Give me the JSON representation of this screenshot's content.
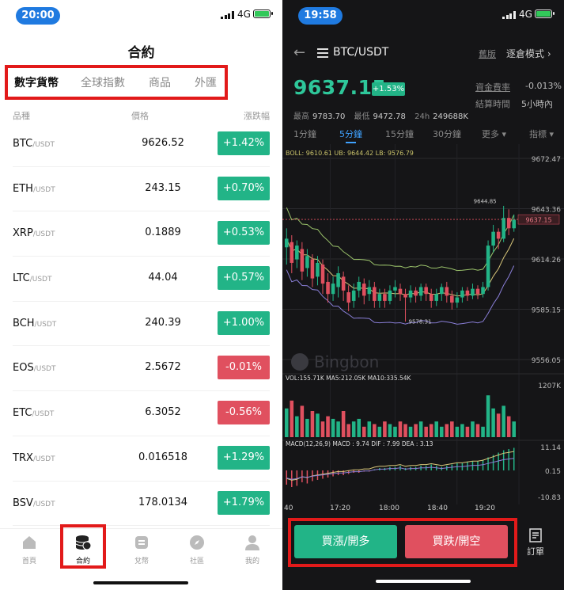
{
  "left": {
    "status": {
      "time": "20:00",
      "network": "4G"
    },
    "title": "合約",
    "category_tabs": [
      "數字貨幣",
      "全球指數",
      "商品",
      "外匯"
    ],
    "columns": {
      "symbol": "品種",
      "price": "價格",
      "change": "漲跌幅"
    },
    "rows": [
      {
        "symbol": "BTC",
        "quote": "/USDT",
        "price": "9626.52",
        "change": "+1.42%",
        "direction": "up"
      },
      {
        "symbol": "ETH",
        "quote": "/USDT",
        "price": "243.15",
        "change": "+0.70%",
        "direction": "up"
      },
      {
        "symbol": "XRP",
        "quote": "/USDT",
        "price": "0.1889",
        "change": "+0.53%",
        "direction": "up"
      },
      {
        "symbol": "LTC",
        "quote": "/USDT",
        "price": "44.04",
        "change": "+0.57%",
        "direction": "up"
      },
      {
        "symbol": "BCH",
        "quote": "/USDT",
        "price": "240.39",
        "change": "+1.00%",
        "direction": "up"
      },
      {
        "symbol": "EOS",
        "quote": "/USDT",
        "price": "2.5672",
        "change": "-0.01%",
        "direction": "down"
      },
      {
        "symbol": "ETC",
        "quote": "/USDT",
        "price": "6.3052",
        "change": "-0.56%",
        "direction": "down"
      },
      {
        "symbol": "TRX",
        "quote": "/USDT",
        "price": "0.016518",
        "change": "+1.29%",
        "direction": "up"
      },
      {
        "symbol": "BSV",
        "quote": "/USDT",
        "price": "178.0134",
        "change": "+1.79%",
        "direction": "up"
      }
    ],
    "nav": [
      {
        "label": "首頁",
        "icon": "home-icon"
      },
      {
        "label": "合約",
        "icon": "coins-icon"
      },
      {
        "label": "兌幣",
        "icon": "exchange-icon"
      },
      {
        "label": "社區",
        "icon": "compass-icon"
      },
      {
        "label": "我的",
        "icon": "user-icon"
      }
    ]
  },
  "right": {
    "status": {
      "time": "19:58",
      "network": "4G"
    },
    "pair": "BTC/USDT",
    "old_version": "舊版",
    "mode": "逐倉模式 ›",
    "price": "9637.15",
    "change_pct": "+1.53%",
    "funding_label": "資金費率",
    "funding_value": "-0.013%",
    "settle_label": "結算時間",
    "settle_value": "5小時內",
    "high_label": "最高",
    "high": "9783.70",
    "low_label": "最低",
    "low": "9472.78",
    "vol_label": "24h",
    "vol": "249688K",
    "timeframes": [
      "1分鐘",
      "5分鐘",
      "15分鐘",
      "30分鐘",
      "更多 ▾",
      "指標 ▾"
    ],
    "active_timeframe": "5分鐘",
    "buy_button": "買漲/開多",
    "sell_button": "買跌/開空",
    "orders_label": "訂單",
    "watermark": "Bingbon",
    "colors": {
      "up": "#22b487",
      "down": "#e0505f",
      "accent": "#3fa2ff"
    }
  },
  "chart_data": {
    "type": "candlestick",
    "boll_label": "BOLL: 9610.61  UB: 9644.42  LB: 9576.79",
    "price_ticks": [
      "9672.47",
      "9643.36",
      "9614.26",
      "9585.15",
      "9556.05"
    ],
    "last_price_tag": "9637.15",
    "high_marker": "9644.85",
    "low_marker": "9578.31",
    "vol_label": "VOL:155.71K  MA5:212.05K  MA10:335.54K",
    "vol_max_tick": "1207K",
    "macd_label": "MACD(12,26,9)  MACD : 9.74  DIF : 7.99  DEA : 3.13",
    "macd_ticks": [
      "11.14",
      "0.15",
      "-10.83"
    ],
    "time_labels": [
      "40",
      "17:20",
      "18:00",
      "18:40",
      "19:20"
    ],
    "ylim": [
      9556.05,
      9672.47
    ],
    "candles": [
      [
        9621,
        9626,
        9611,
        9632
      ],
      [
        9624,
        9612,
        9606,
        9628
      ],
      [
        9614,
        9622,
        9609,
        9625
      ],
      [
        9620,
        9607,
        9602,
        9624
      ],
      [
        9609,
        9616,
        9604,
        9620
      ],
      [
        9614,
        9603,
        9598,
        9617
      ],
      [
        9604,
        9612,
        9599,
        9616
      ],
      [
        9611,
        9600,
        9594,
        9614
      ],
      [
        9601,
        9594,
        9589,
        9606
      ],
      [
        9594,
        9600,
        9590,
        9604
      ],
      [
        9598,
        9606,
        9592,
        9610
      ],
      [
        9604,
        9596,
        9590,
        9607
      ],
      [
        9595,
        9589,
        9584,
        9599
      ],
      [
        9590,
        9596,
        9586,
        9600
      ],
      [
        9596,
        9601,
        9592,
        9604
      ],
      [
        9600,
        9593,
        9588,
        9603
      ],
      [
        9594,
        9598,
        9590,
        9602
      ],
      [
        9598,
        9590,
        9586,
        9601
      ],
      [
        9590,
        9594,
        9586,
        9597
      ],
      [
        9594,
        9590,
        9586,
        9597
      ],
      [
        9590,
        9596,
        9588,
        9599
      ],
      [
        9596,
        9598,
        9592,
        9602
      ],
      [
        9597,
        9594,
        9590,
        9600
      ],
      [
        9594,
        9592,
        9578,
        9597
      ],
      [
        9592,
        9596,
        9589,
        9599
      ],
      [
        9596,
        9593,
        9589,
        9598
      ],
      [
        9593,
        9598,
        9590,
        9600
      ],
      [
        9598,
        9594,
        9590,
        9600
      ],
      [
        9594,
        9590,
        9586,
        9597
      ],
      [
        9590,
        9594,
        9587,
        9597
      ],
      [
        9594,
        9598,
        9590,
        9600
      ],
      [
        9598,
        9593,
        9589,
        9601
      ],
      [
        9593,
        9589,
        9585,
        9596
      ],
      [
        9589,
        9592,
        9586,
        9595
      ],
      [
        9592,
        9596,
        9589,
        9598
      ],
      [
        9596,
        9593,
        9590,
        9598
      ],
      [
        9593,
        9597,
        9591,
        9600
      ],
      [
        9597,
        9594,
        9591,
        9599
      ],
      [
        9594,
        9598,
        9592,
        9601
      ],
      [
        9598,
        9622,
        9596,
        9625
      ],
      [
        9622,
        9630,
        9618,
        9634
      ],
      [
        9630,
        9626,
        9620,
        9632
      ],
      [
        9626,
        9638,
        9624,
        9645
      ],
      [
        9638,
        9632,
        9628,
        9643
      ],
      [
        9632,
        9637,
        9630,
        9640
      ]
    ],
    "volume": [
      0.55,
      0.7,
      0.4,
      0.6,
      0.35,
      0.5,
      0.45,
      0.3,
      0.4,
      0.35,
      0.3,
      0.5,
      0.25,
      0.3,
      0.35,
      0.2,
      0.3,
      0.25,
      0.2,
      0.3,
      0.25,
      0.2,
      0.3,
      0.25,
      0.2,
      0.25,
      0.3,
      0.2,
      0.25,
      0.3,
      0.2,
      0.25,
      0.3,
      0.2,
      0.25,
      0.2,
      0.3,
      0.25,
      0.2,
      0.8,
      0.55,
      0.45,
      0.6,
      0.4,
      0.3
    ],
    "macd": [
      -0.6,
      -0.7,
      -0.65,
      -0.5,
      -0.55,
      -0.45,
      -0.4,
      -0.35,
      -0.3,
      -0.25,
      -0.2,
      -0.2,
      -0.15,
      -0.1,
      -0.1,
      -0.05,
      -0.05,
      0.05,
      0.1,
      0.1,
      0.15,
      0.15,
      0.2,
      0.1,
      0.15,
      0.15,
      0.2,
      0.2,
      0.25,
      0.2,
      0.15,
      0.2,
      0.25,
      0.3,
      0.3,
      0.35,
      0.4,
      0.4,
      0.45,
      0.55,
      0.65,
      0.75,
      0.85,
      0.9,
      0.95
    ]
  }
}
